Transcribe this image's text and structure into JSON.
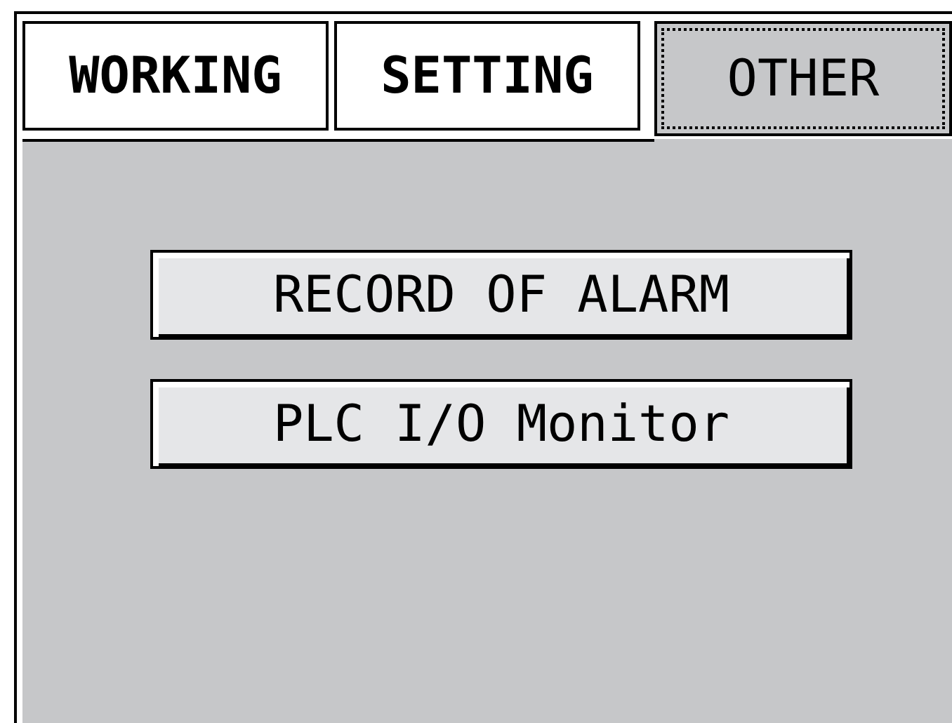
{
  "tabs": [
    {
      "label": "WORKING",
      "selected": false
    },
    {
      "label": "SETTING",
      "selected": false
    },
    {
      "label": "OTHER",
      "selected": true
    }
  ],
  "buttons": [
    "RECORD OF ALARM",
    "PLC I/O Monitor"
  ]
}
